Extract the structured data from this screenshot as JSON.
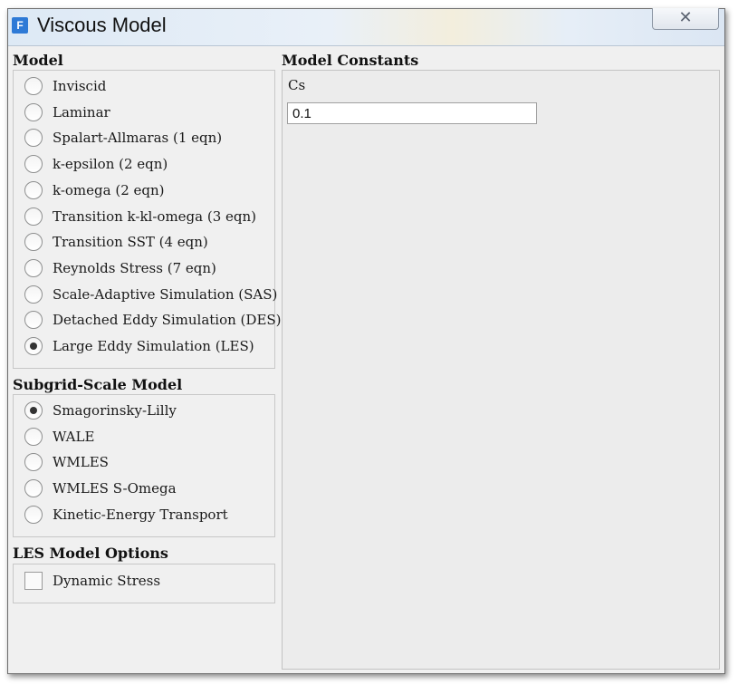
{
  "window": {
    "title": "Viscous Model",
    "app_icon_letter": "F",
    "close_glyph": "✕"
  },
  "model": {
    "heading": "Model",
    "options": [
      {
        "label": "Inviscid",
        "selected": false
      },
      {
        "label": "Laminar",
        "selected": false
      },
      {
        "label": "Spalart-Allmaras (1 eqn)",
        "selected": false
      },
      {
        "label": "k-epsilon (2 eqn)",
        "selected": false
      },
      {
        "label": "k-omega (2 eqn)",
        "selected": false
      },
      {
        "label": "Transition k-kl-omega (3 eqn)",
        "selected": false
      },
      {
        "label": "Transition SST (4 eqn)",
        "selected": false
      },
      {
        "label": "Reynolds Stress (7 eqn)",
        "selected": false
      },
      {
        "label": "Scale-Adaptive Simulation (SAS)",
        "selected": false
      },
      {
        "label": "Detached Eddy Simulation (DES)",
        "selected": false
      },
      {
        "label": "Large Eddy Simulation (LES)",
        "selected": true
      }
    ]
  },
  "subgrid": {
    "heading": "Subgrid-Scale Model",
    "options": [
      {
        "label": "Smagorinsky-Lilly",
        "selected": true
      },
      {
        "label": "WALE",
        "selected": false
      },
      {
        "label": "WMLES",
        "selected": false
      },
      {
        "label": "WMLES S-Omega",
        "selected": false
      },
      {
        "label": "Kinetic-Energy Transport",
        "selected": false
      }
    ]
  },
  "les_options": {
    "heading": "LES Model Options",
    "checkbox": {
      "label": "Dynamic Stress",
      "checked": false
    }
  },
  "constants": {
    "heading": "Model Constants",
    "cs_label": "Cs",
    "cs_value": "0.1"
  }
}
